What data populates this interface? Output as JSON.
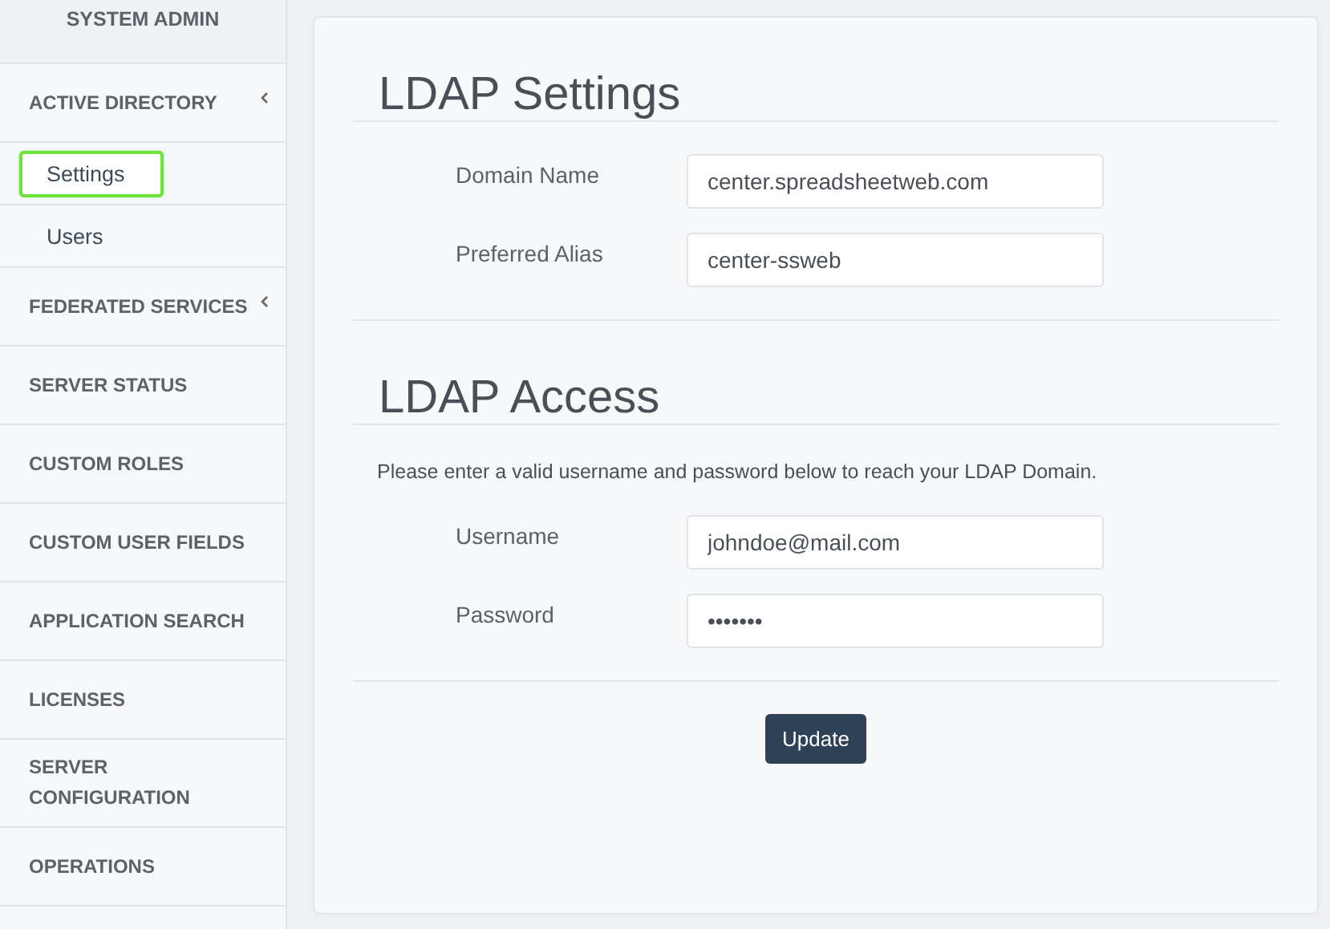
{
  "sidebar": {
    "header": "SYSTEM ADMIN",
    "items": [
      {
        "label": "ACTIVE DIRECTORY",
        "has_submenu": true,
        "children": [
          {
            "label": "Settings",
            "selected": true
          },
          {
            "label": "Users",
            "selected": false
          }
        ]
      },
      {
        "label": "FEDERATED SERVICES",
        "has_submenu": true
      },
      {
        "label": "SERVER STATUS",
        "has_submenu": false
      },
      {
        "label": "CUSTOM ROLES",
        "has_submenu": false
      },
      {
        "label": "CUSTOM USER FIELDS",
        "has_submenu": false
      },
      {
        "label": "APPLICATION SEARCH",
        "has_submenu": false
      },
      {
        "label": "LICENSES",
        "has_submenu": false
      },
      {
        "label": "SERVER CONFIGURATION",
        "has_submenu": false
      },
      {
        "label": "OPERATIONS",
        "has_submenu": false
      }
    ]
  },
  "main": {
    "sections": [
      {
        "title": "LDAP Settings",
        "fields": [
          {
            "label": "Domain Name",
            "value": "center.spreadsheetweb.com"
          },
          {
            "label": "Preferred Alias",
            "value": "center-ssweb"
          }
        ]
      },
      {
        "title": "LDAP Access",
        "description": "Please enter a valid username and password below to reach your LDAP Domain.",
        "fields": [
          {
            "label": "Username",
            "value": "johndoe@mail.com"
          },
          {
            "label": "Password",
            "value": "•••••••"
          }
        ]
      }
    ],
    "button": "Update"
  }
}
